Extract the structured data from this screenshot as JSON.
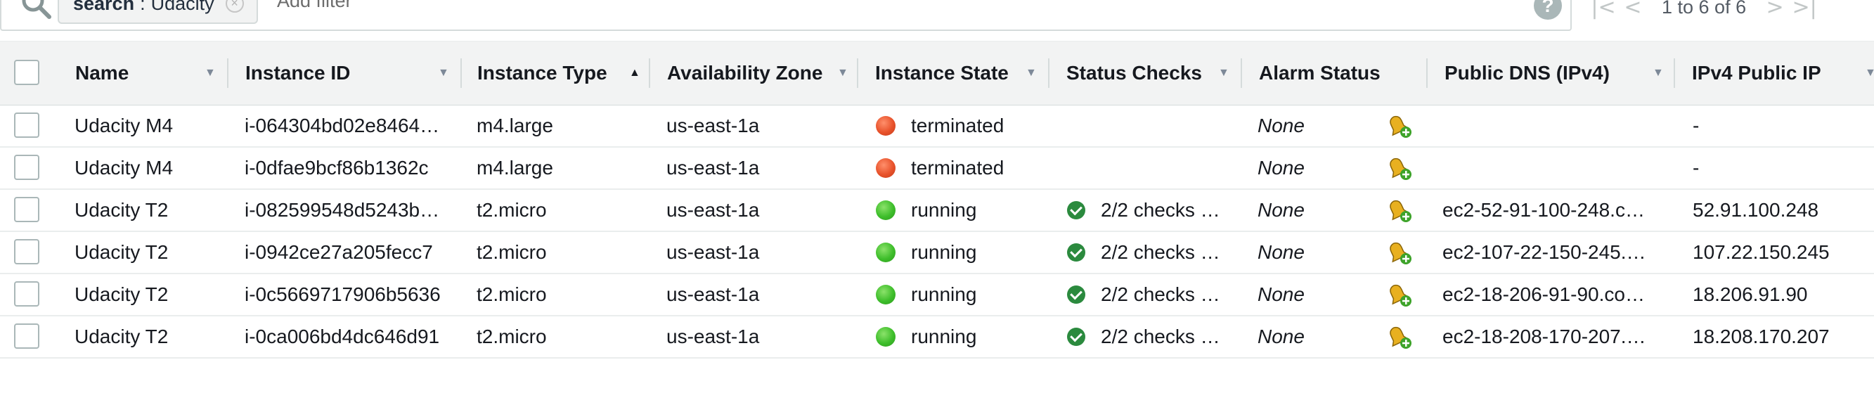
{
  "filter": {
    "token_key": "search",
    "token_sep": ":",
    "token_value": "Udacity",
    "placeholder": "Add filter"
  },
  "pagination": {
    "text": "1 to 6 of 6",
    "first_icon": "first-page-icon",
    "prev_icon": "previous-page-icon",
    "next_icon": "next-page-icon",
    "last_icon": "last-page-icon"
  },
  "columns": [
    {
      "key": "name",
      "label": "Name",
      "sort": "none"
    },
    {
      "key": "instance_id",
      "label": "Instance ID",
      "sort": "none"
    },
    {
      "key": "instance_type",
      "label": "Instance Type",
      "sort": "ascending"
    },
    {
      "key": "availability_zone",
      "label": "Availability Zone",
      "sort": "none"
    },
    {
      "key": "instance_state",
      "label": "Instance State",
      "sort": "none"
    },
    {
      "key": "status_checks",
      "label": "Status Checks",
      "sort": "none"
    },
    {
      "key": "alarm_status",
      "label": "Alarm Status",
      "sort": "none"
    },
    {
      "key": "public_dns",
      "label": "Public DNS (IPv4)",
      "sort": "none"
    },
    {
      "key": "ipv4_public_ip",
      "label": "IPv4 Public IP",
      "sort": "none"
    }
  ],
  "rows": [
    {
      "name": "Udacity M4",
      "instance_id": "i-064304bd02e8464…",
      "instance_type": "m4.large",
      "availability_zone": "us-east-1a",
      "state": "terminated",
      "state_color": "red",
      "status_checks": "",
      "alarm_status": "None",
      "public_dns": "",
      "ipv4_public_ip": "-"
    },
    {
      "name": "Udacity M4",
      "instance_id": "i-0dfae9bcf86b1362c",
      "instance_type": "m4.large",
      "availability_zone": "us-east-1a",
      "state": "terminated",
      "state_color": "red",
      "status_checks": "",
      "alarm_status": "None",
      "public_dns": "",
      "ipv4_public_ip": "-"
    },
    {
      "name": "Udacity T2",
      "instance_id": "i-082599548d5243b…",
      "instance_type": "t2.micro",
      "availability_zone": "us-east-1a",
      "state": "running",
      "state_color": "green",
      "status_checks": "2/2 checks …",
      "alarm_status": "None",
      "public_dns": "ec2-52-91-100-248.c…",
      "ipv4_public_ip": "52.91.100.248"
    },
    {
      "name": "Udacity T2",
      "instance_id": "i-0942ce27a205fecc7",
      "instance_type": "t2.micro",
      "availability_zone": "us-east-1a",
      "state": "running",
      "state_color": "green",
      "status_checks": "2/2 checks …",
      "alarm_status": "None",
      "public_dns": "ec2-107-22-150-245.…",
      "ipv4_public_ip": "107.22.150.245"
    },
    {
      "name": "Udacity T2",
      "instance_id": "i-0c5669717906b5636",
      "instance_type": "t2.micro",
      "availability_zone": "us-east-1a",
      "state": "running",
      "state_color": "green",
      "status_checks": "2/2 checks …",
      "alarm_status": "None",
      "public_dns": "ec2-18-206-91-90.co…",
      "ipv4_public_ip": "18.206.91.90"
    },
    {
      "name": "Udacity T2",
      "instance_id": "i-0ca006bd4dc646d91",
      "instance_type": "t2.micro",
      "availability_zone": "us-east-1a",
      "state": "running",
      "state_color": "green",
      "status_checks": "2/2 checks …",
      "alarm_status": "None",
      "public_dns": "ec2-18-208-170-207.…",
      "ipv4_public_ip": "18.208.170.207"
    }
  ],
  "icons": {
    "search": "search-icon",
    "help": "help-icon",
    "alarm": "create-alarm-icon",
    "status_ok": "status-check-passed-icon"
  },
  "colors": {
    "terminated": "#e8522b",
    "running": "#3ebe2b",
    "check_ok": "#2b8a3e",
    "header_bg": "#f2f3f3",
    "border": "#d5dbdb"
  }
}
